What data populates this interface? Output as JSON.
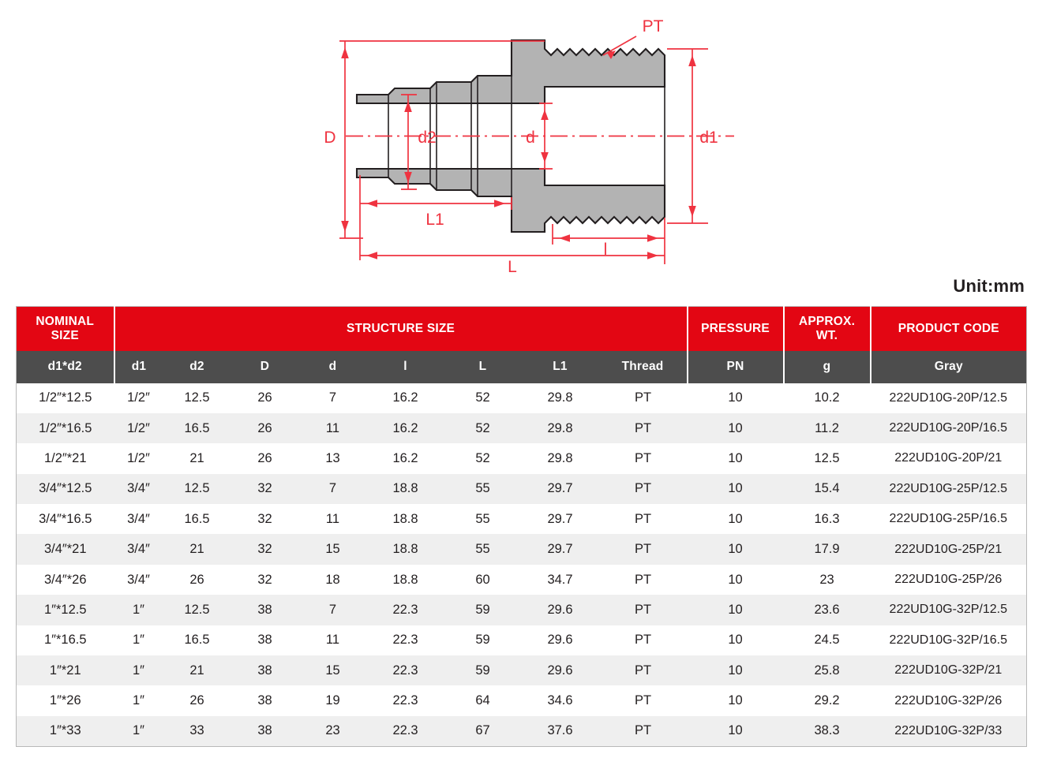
{
  "drawing": {
    "labels": {
      "D": "D",
      "d2": "d2",
      "d": "d",
      "d_right": "d",
      "d1": "d1",
      "L1": "L1",
      "L": "L",
      "l": "l",
      "PT": "PT"
    },
    "colors": {
      "dimension": "#ef3340",
      "body_fill": "#b3b3b3",
      "body_stroke": "#231f20"
    }
  },
  "unit_label": "Unit:mm",
  "table": {
    "colors": {
      "header_red": "#e30613",
      "header_gray": "#4d4d4d",
      "stripe": "#efefef",
      "border": "#b8b8b8"
    },
    "group_headers": [
      {
        "label": "NOMINAL\nSIZE",
        "line1": "NOMINAL",
        "line2": "SIZE",
        "span": 1
      },
      {
        "label": "STRUCTURE SIZE",
        "line1": "STRUCTURE SIZE",
        "line2": "",
        "span": 8
      },
      {
        "label": "PRESSURE",
        "line1": "PRESSURE",
        "line2": "",
        "span": 1
      },
      {
        "label": "APPROX. WT.",
        "line1": "APPROX.",
        "line2": "WT.",
        "span": 1
      },
      {
        "label": "PRODUCT CODE",
        "line1": "PRODUCT CODE",
        "line2": "",
        "span": 1
      }
    ],
    "sub_headers": [
      "d1*d2",
      "d1",
      "d2",
      "D",
      "d",
      "l",
      "L",
      "L1",
      "Thread",
      "PN",
      "g",
      "Gray"
    ],
    "rows": [
      [
        "1/2″*12.5",
        "1/2″",
        "12.5",
        "26",
        "7",
        "16.2",
        "52",
        "29.8",
        "PT",
        "10",
        "10.2",
        "222UD10G-20P/12.5"
      ],
      [
        "1/2″*16.5",
        "1/2″",
        "16.5",
        "26",
        "11",
        "16.2",
        "52",
        "29.8",
        "PT",
        "10",
        "11.2",
        "222UD10G-20P/16.5"
      ],
      [
        "1/2″*21",
        "1/2″",
        "21",
        "26",
        "13",
        "16.2",
        "52",
        "29.8",
        "PT",
        "10",
        "12.5",
        "222UD10G-20P/21"
      ],
      [
        "3/4″*12.5",
        "3/4″",
        "12.5",
        "32",
        "7",
        "18.8",
        "55",
        "29.7",
        "PT",
        "10",
        "15.4",
        "222UD10G-25P/12.5"
      ],
      [
        "3/4″*16.5",
        "3/4″",
        "16.5",
        "32",
        "11",
        "18.8",
        "55",
        "29.7",
        "PT",
        "10",
        "16.3",
        "222UD10G-25P/16.5"
      ],
      [
        "3/4″*21",
        "3/4″",
        "21",
        "32",
        "15",
        "18.8",
        "55",
        "29.7",
        "PT",
        "10",
        "17.9",
        "222UD10G-25P/21"
      ],
      [
        "3/4″*26",
        "3/4″",
        "26",
        "32",
        "18",
        "18.8",
        "60",
        "34.7",
        "PT",
        "10",
        "23",
        "222UD10G-25P/26"
      ],
      [
        "1″*12.5",
        "1″",
        "12.5",
        "38",
        "7",
        "22.3",
        "59",
        "29.6",
        "PT",
        "10",
        "23.6",
        "222UD10G-32P/12.5"
      ],
      [
        "1″*16.5",
        "1″",
        "16.5",
        "38",
        "11",
        "22.3",
        "59",
        "29.6",
        "PT",
        "10",
        "24.5",
        "222UD10G-32P/16.5"
      ],
      [
        "1″*21",
        "1″",
        "21",
        "38",
        "15",
        "22.3",
        "59",
        "29.6",
        "PT",
        "10",
        "25.8",
        "222UD10G-32P/21"
      ],
      [
        "1″*26",
        "1″",
        "26",
        "38",
        "19",
        "22.3",
        "64",
        "34.6",
        "PT",
        "10",
        "29.2",
        "222UD10G-32P/26"
      ],
      [
        "1″*33",
        "1″",
        "33",
        "38",
        "23",
        "22.3",
        "67",
        "37.6",
        "PT",
        "10",
        "38.3",
        "222UD10G-32P/33"
      ]
    ]
  }
}
